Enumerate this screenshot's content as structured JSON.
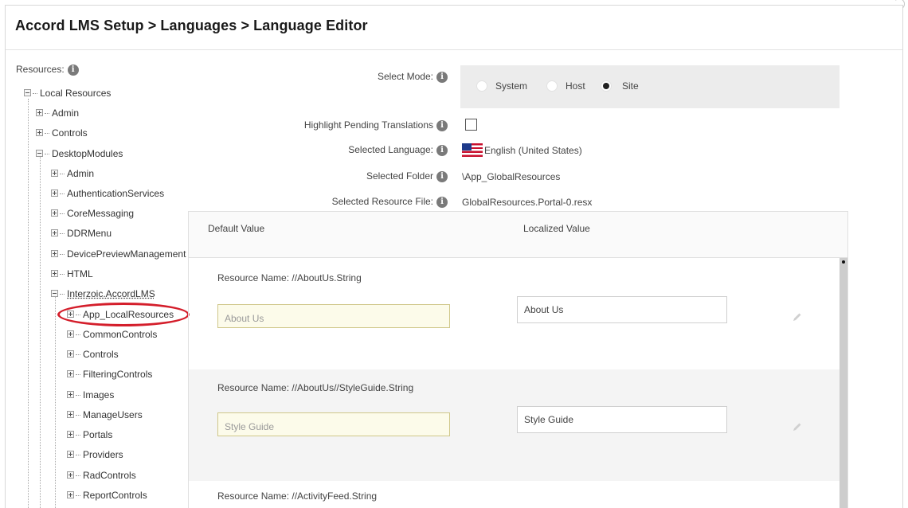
{
  "page": {
    "title": "Accord LMS Setup > Languages > Language Editor"
  },
  "tree": {
    "label": "Resources:",
    "nodes": [
      {
        "label": "Local Resources",
        "expanded": true
      },
      {
        "label": "Admin",
        "expanded": false
      },
      {
        "label": "Controls",
        "expanded": false
      },
      {
        "label": "DesktopModules",
        "expanded": true
      },
      {
        "label": "Admin",
        "expanded": false
      },
      {
        "label": "AuthenticationServices",
        "expanded": false
      },
      {
        "label": "CoreMessaging",
        "expanded": false
      },
      {
        "label": "DDRMenu",
        "expanded": false
      },
      {
        "label": "DevicePreviewManagement",
        "expanded": false
      },
      {
        "label": "HTML",
        "expanded": false
      },
      {
        "label": "Interzoic.AccordLMS",
        "expanded": true
      },
      {
        "label": "App_LocalResources",
        "expanded": false,
        "highlighted": true
      },
      {
        "label": "CommonControls",
        "expanded": false
      },
      {
        "label": "Controls",
        "expanded": false
      },
      {
        "label": "FilteringControls",
        "expanded": false
      },
      {
        "label": "Images",
        "expanded": false
      },
      {
        "label": "ManageUsers",
        "expanded": false
      },
      {
        "label": "Portals",
        "expanded": false
      },
      {
        "label": "Providers",
        "expanded": false
      },
      {
        "label": "RadControls",
        "expanded": false
      },
      {
        "label": "ReportControls",
        "expanded": false
      }
    ]
  },
  "form": {
    "select_mode_label": "Select Mode:",
    "modes": [
      {
        "label": "System",
        "checked": false
      },
      {
        "label": "Host",
        "checked": false
      },
      {
        "label": "Site",
        "checked": true
      }
    ],
    "highlight_label": "Highlight Pending Translations",
    "highlight_checked": false,
    "language_label": "Selected Language:",
    "language_value": "English (United States)",
    "folder_label": "Selected Folder",
    "folder_value": "\\App_GlobalResources",
    "resource_file_label": "Selected Resource File:",
    "resource_file_value": "GlobalResources.Portal-0.resx"
  },
  "grid": {
    "col_default": "Default Value",
    "col_localized": "Localized Value",
    "rows": [
      {
        "resource_name": "Resource Name: //AboutUs.String",
        "default_value": "About Us",
        "localized_value": "About Us"
      },
      {
        "resource_name": "Resource Name: //AboutUs//StyleGuide.String",
        "default_value": "Style Guide",
        "localized_value": "Style Guide"
      },
      {
        "resource_name": "Resource Name: //ActivityFeed.String",
        "default_value": "",
        "localized_value": ""
      }
    ]
  },
  "colors": {
    "highlight_ring": "#d41e2b",
    "default_input_bg": "#fcfbea",
    "mode_box_bg": "#ececec"
  }
}
